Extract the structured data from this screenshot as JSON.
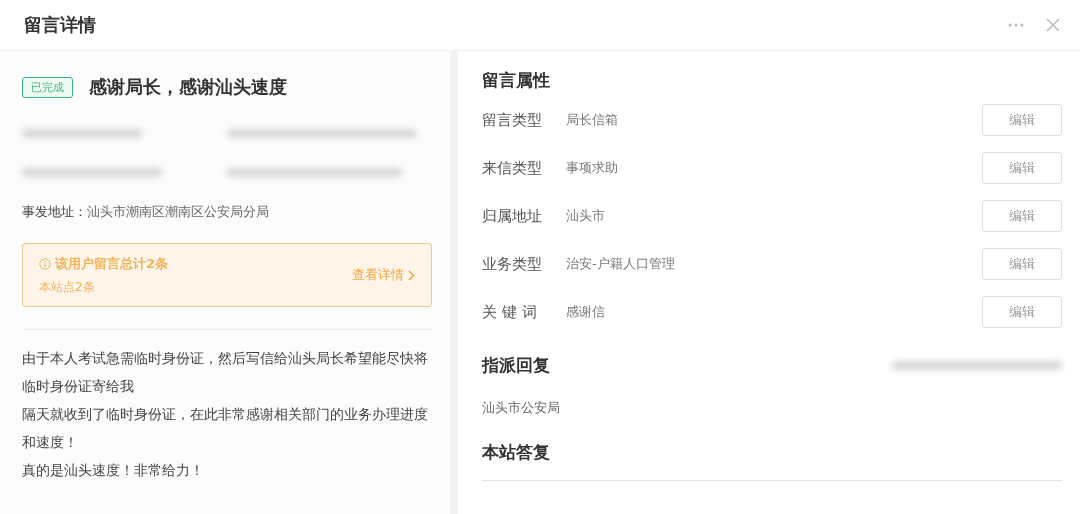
{
  "window": {
    "title": "留言详情"
  },
  "message": {
    "status": "已完成",
    "title": "感谢局长，感谢汕头速度",
    "address_label": "事发地址：",
    "address": "汕头市潮南区潮南区公安局分局",
    "notice": {
      "text": "该用户留言总计2条",
      "sub": "本站点2条",
      "link": "查看详情"
    },
    "body": [
      "由于本人考试急需临时身份证，然后写信给汕头局长希望能尽快将临时身份证寄给我",
      "隔天就收到了临时身份证，在此非常感谢相关部门的业务办理进度和速度！",
      "真的是汕头速度！非常给力！"
    ]
  },
  "attributes": {
    "heading": "留言属性",
    "rows": [
      {
        "label": "留言类型",
        "value": "局长信箱",
        "button": "编辑"
      },
      {
        "label": "来信类型",
        "value": "事项求助",
        "button": "编辑"
      },
      {
        "label": "归属地址",
        "value": "汕头市",
        "button": "编辑"
      },
      {
        "label": "业务类型",
        "value": "治安-户籍人口管理",
        "button": "编辑"
      },
      {
        "label": "关 键 词",
        "value": "感谢信",
        "button": "编辑"
      }
    ]
  },
  "assignment": {
    "heading": "指派回复",
    "value": "汕头市公安局"
  },
  "reply": {
    "heading": "本站答复"
  }
}
